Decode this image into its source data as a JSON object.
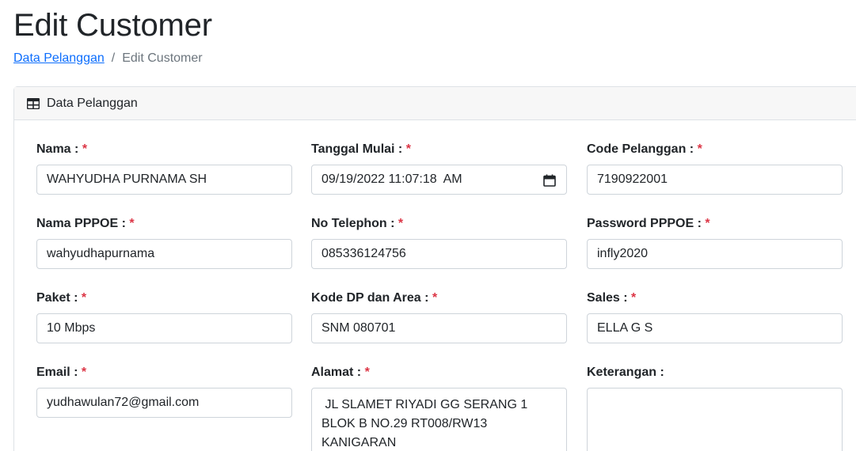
{
  "page": {
    "title": "Edit Customer"
  },
  "breadcrumb": {
    "parent": "Data Pelanggan",
    "separator": "/",
    "current": "Edit Customer"
  },
  "card": {
    "header_icon": "table-icon",
    "header_title": "Data Pelanggan"
  },
  "required_mark": "*",
  "fields": {
    "nama": {
      "label": "Nama :",
      "value": "WAHYUDHA PURNAMA SH"
    },
    "tanggal_mulai": {
      "label": "Tanggal Mulai :",
      "value": "09/19/2022 11:07:18  AM",
      "icon": "calendar-icon"
    },
    "code_pelanggan": {
      "label": "Code Pelanggan :",
      "value": "7190922001"
    },
    "nama_pppoe": {
      "label": "Nama PPPOE :",
      "value": "wahyudhapurnama"
    },
    "no_telephon": {
      "label": "No Telephon :",
      "value": "085336124756"
    },
    "password_pppoe": {
      "label": "Password PPPOE :",
      "value": "infly2020"
    },
    "paket": {
      "label": "Paket :",
      "value": "10 Mbps"
    },
    "kode_dp": {
      "label": "Kode DP dan Area :",
      "value": "SNM 080701"
    },
    "sales": {
      "label": "Sales :",
      "value": "ELLA G S"
    },
    "email": {
      "label": "Email :",
      "value": "yudhawulan72@gmail.com"
    },
    "alamat": {
      "label": "Alamat :",
      "value": " JL SLAMET RIYADI GG SERANG 1 BLOK B NO.29 RT008/RW13 KANIGARAN"
    },
    "keterangan": {
      "label": "Keterangan :",
      "value": ""
    }
  }
}
